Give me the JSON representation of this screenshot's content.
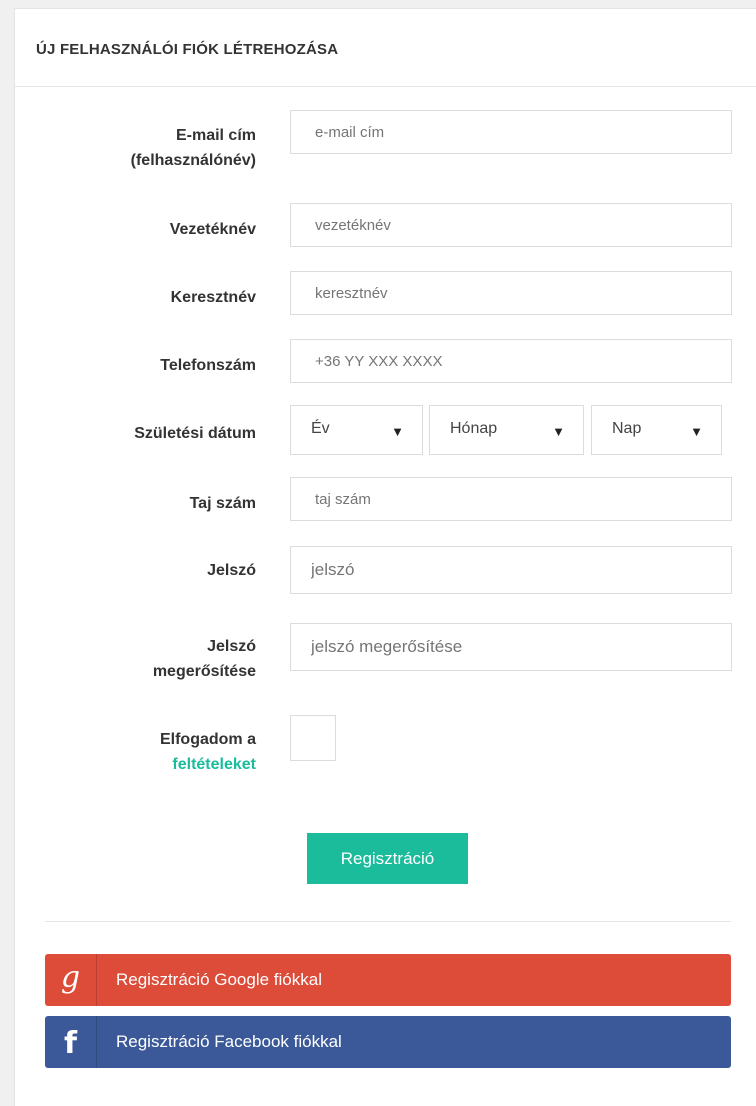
{
  "header": {
    "title": "ÚJ FELHASZNÁLÓI FIÓK LÉTREHOZÁSA"
  },
  "form": {
    "email": {
      "label_line1": "E-mail cím",
      "label_line2": "(felhasználónév)",
      "placeholder": "e-mail cím"
    },
    "lastname": {
      "label": "Vezetéknév",
      "placeholder": "vezetéknév"
    },
    "firstname": {
      "label": "Keresztnév",
      "placeholder": "keresztnév"
    },
    "phone": {
      "label": "Telefonszám",
      "placeholder": "+36 YY XXX XXXX"
    },
    "birthdate": {
      "label": "Születési dátum",
      "year": "Év",
      "month": "Hónap",
      "day": "Nap"
    },
    "taj": {
      "label": "Taj szám",
      "placeholder": "taj szám"
    },
    "password": {
      "label": "Jelszó",
      "placeholder": "jelszó"
    },
    "password_confirm": {
      "label_line1": "Jelszó",
      "label_line2": "megerősítése",
      "placeholder": "jelszó megerősítése"
    },
    "terms": {
      "label_line1": "Elfogadom a",
      "link": "feltételeket"
    },
    "submit_label": "Regisztráció"
  },
  "social": {
    "google": {
      "icon": "g",
      "label": "Regisztráció Google fiókkal",
      "color": "#dd4b39"
    },
    "facebook": {
      "icon": "f",
      "label": "Regisztráció Facebook fiókkal",
      "color": "#3b5998"
    }
  },
  "colors": {
    "accent": "#1abc9c"
  }
}
